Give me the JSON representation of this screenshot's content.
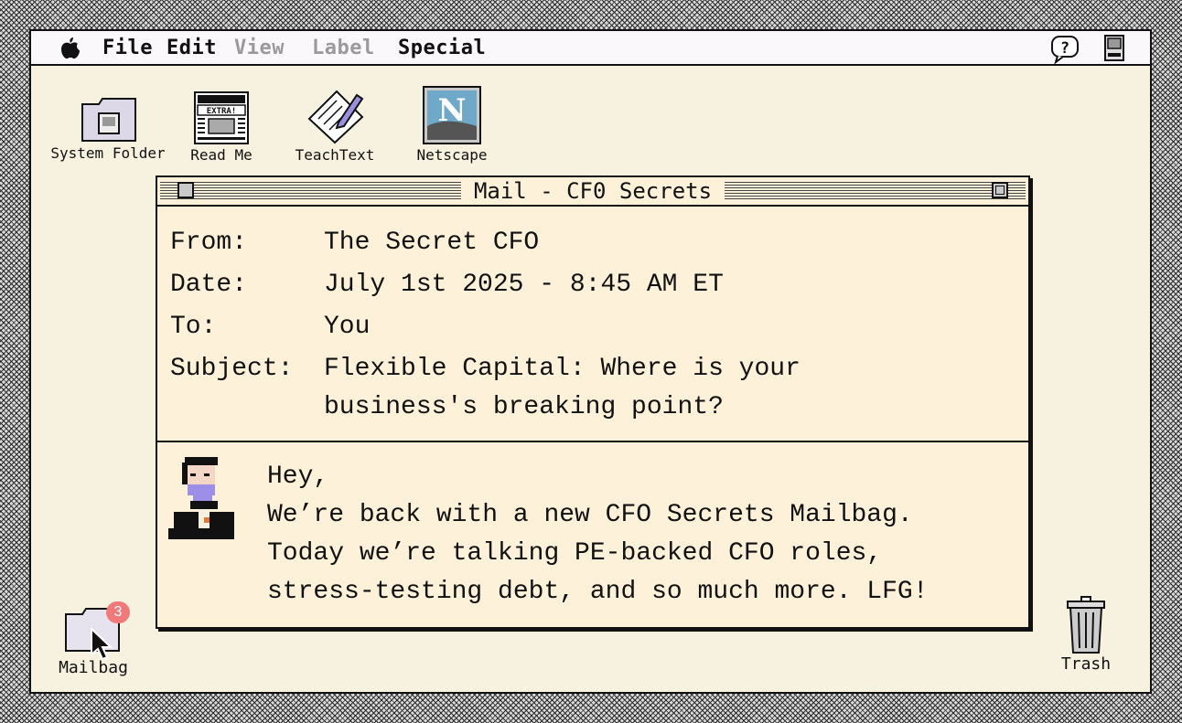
{
  "menubar": {
    "items": [
      {
        "label": "File",
        "enabled": true
      },
      {
        "label": "Edit",
        "enabled": true
      },
      {
        "label": "View",
        "enabled": false
      },
      {
        "label": "Label",
        "enabled": false
      },
      {
        "label": "Special",
        "enabled": true
      }
    ],
    "apple_icon": "apple-icon",
    "help_icon": "help-balloon-icon",
    "app_icon": "finder-app-icon"
  },
  "desktop": {
    "icons": [
      {
        "label": "System Folder",
        "icon": "system-folder-icon"
      },
      {
        "label": "Read Me",
        "icon": "newspaper-icon"
      },
      {
        "label": "TeachText",
        "icon": "teachtext-icon"
      },
      {
        "label": "Netscape",
        "icon": "netscape-icon"
      }
    ],
    "mailbag": {
      "label": "Mailbag",
      "badge": "3"
    },
    "trash": {
      "label": "Trash"
    }
  },
  "window": {
    "title": "Mail - CF0 Secrets",
    "headers": {
      "from_key": "From:",
      "from_val": "The Secret CFO",
      "date_key": "Date:",
      "date_val": "July 1st 2025 - 8:45 AM ET",
      "to_key": "To:",
      "to_val": "You",
      "subject_key": "Subject:",
      "subject_line1": "Flexible Capital: Where is your",
      "subject_line2": "business's breaking point?"
    },
    "body": [
      "Hey,",
      "We’re back with a new CFO Secrets Mailbag.",
      "Today we’re talking PE-backed CFO roles,",
      "stress-testing debt, and so much more. LFG!"
    ]
  },
  "colors": {
    "desktop": "#f7f1df",
    "window": "#fdf1d9",
    "badge": "#f07a7a"
  }
}
